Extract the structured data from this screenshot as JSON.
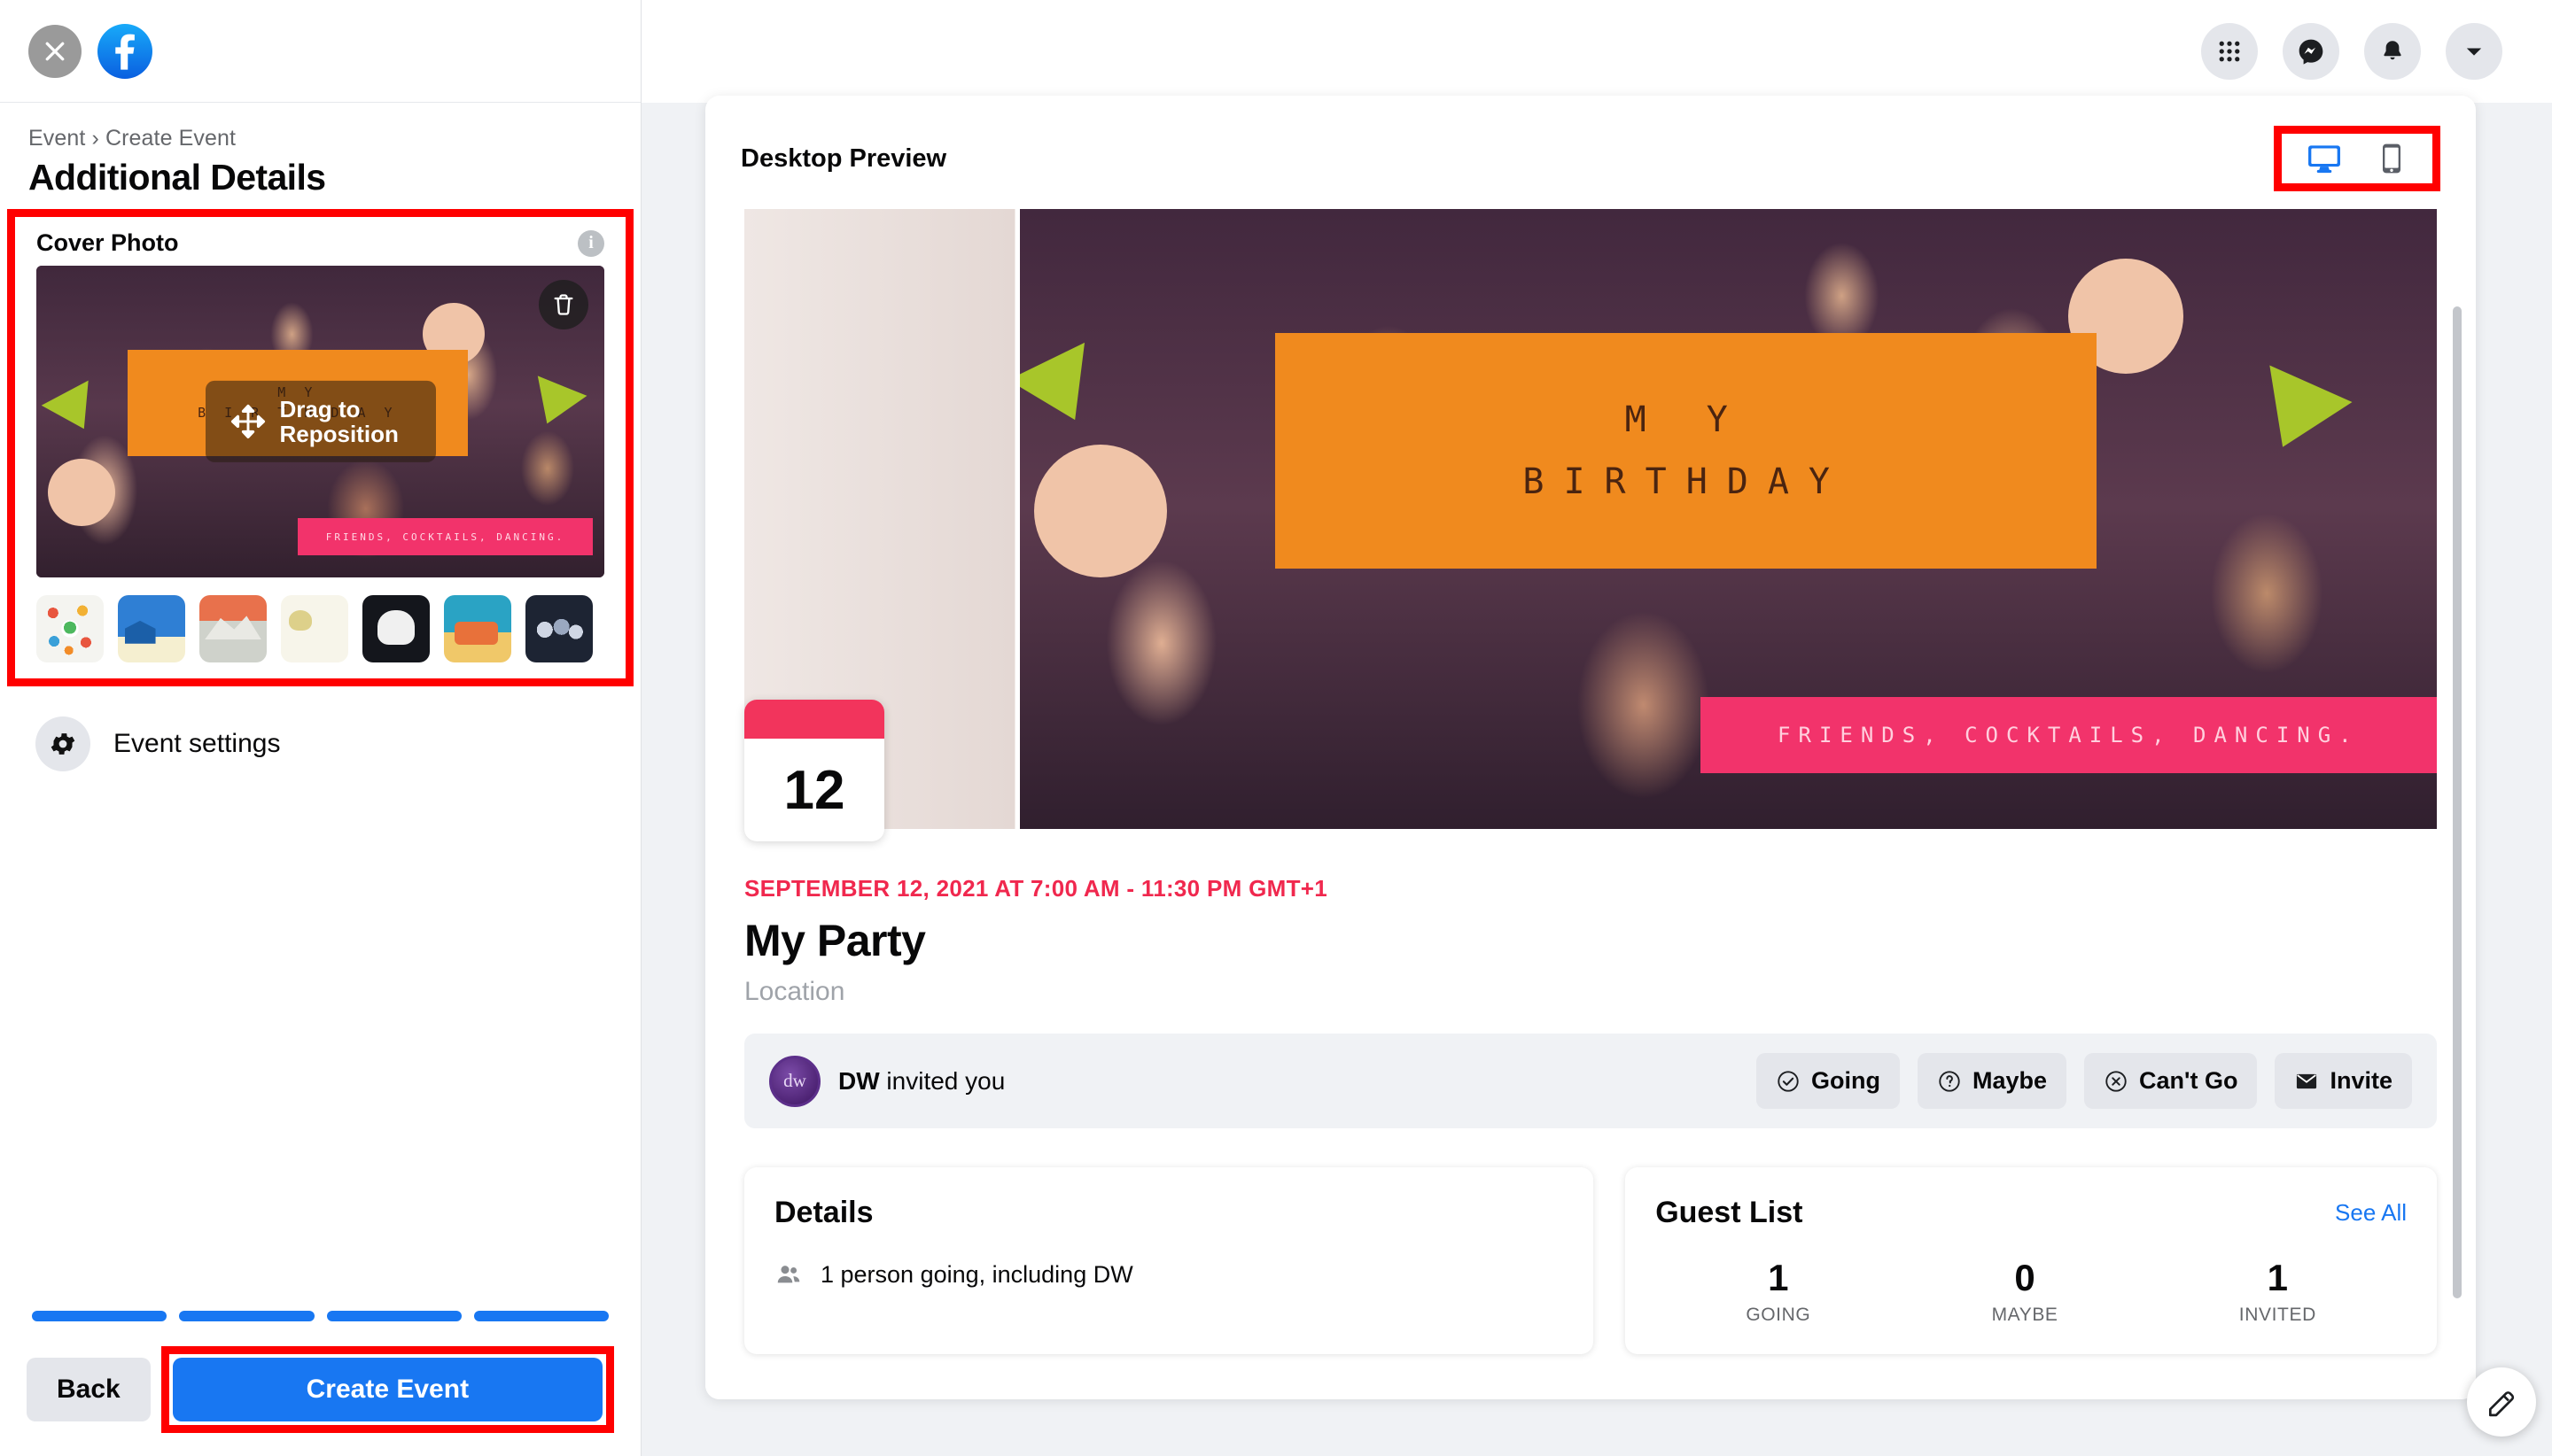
{
  "left_panel": {
    "close_icon": "close-icon",
    "logo_icon": "facebook-logo",
    "breadcrumb": "Event › Create Event",
    "page_title": "Additional Details",
    "cover_photo": {
      "label": "Cover Photo",
      "info_icon": "info-icon",
      "info_char": "i",
      "delete_icon": "trash-icon",
      "drag_icon": "move-icon",
      "drag_text": "Drag to Reposition",
      "image_band_line1": "M Y",
      "image_band_line2": "B I R T H D A Y",
      "image_pink_text": "FRIENDS, COCKTAILS, DANCING.",
      "thumbnails": [
        {
          "name": "thumbnail-picnic"
        },
        {
          "name": "thumbnail-winter-village"
        },
        {
          "name": "thumbnail-ski-mountain"
        },
        {
          "name": "thumbnail-desert-balloon"
        },
        {
          "name": "thumbnail-halloween-ghost"
        },
        {
          "name": "thumbnail-beach-sunset"
        },
        {
          "name": "thumbnail-night-crowd"
        }
      ]
    },
    "settings_row": {
      "icon": "gear-icon",
      "label": "Event settings"
    },
    "footer": {
      "progress_segments": 4,
      "back_label": "Back",
      "create_label": "Create Event"
    }
  },
  "top_nav": {
    "items": [
      {
        "name": "grid-menu-icon"
      },
      {
        "name": "messenger-icon"
      },
      {
        "name": "notifications-bell-icon"
      },
      {
        "name": "account-chevron-down-icon"
      }
    ]
  },
  "preview": {
    "title": "Desktop Preview",
    "device_toggle": {
      "desktop": {
        "name": "desktop-icon",
        "active": true,
        "color": "#1877f2"
      },
      "mobile": {
        "name": "mobile-icon",
        "active": false,
        "color": "#5a5e66"
      }
    },
    "hero": {
      "line1": "M Y",
      "line2": "BIRTHDAY",
      "pink_text": "FRIENDS, COCKTAILS, DANCING."
    },
    "calendar_day": "12",
    "event_date": "SEPTEMBER 12, 2021 AT 7:00 AM - 11:30 PM GMT+1",
    "event_name": "My Party",
    "event_location": "Location",
    "rsvp": {
      "avatar_initials": "dw",
      "inviter": "DW",
      "invited_text": " invited you",
      "buttons": [
        {
          "label": "Going",
          "icon": "check-circle-icon"
        },
        {
          "label": "Maybe",
          "icon": "question-circle-icon"
        },
        {
          "label": "Can't Go",
          "icon": "x-circle-icon"
        },
        {
          "label": "Invite",
          "icon": "envelope-icon"
        }
      ]
    },
    "details_card": {
      "title": "Details",
      "line_icon": "people-icon",
      "line_text": "1 person going, including DW"
    },
    "guest_card": {
      "title": "Guest List",
      "see_all": "See All",
      "stats": [
        {
          "number": "1",
          "label": "GOING"
        },
        {
          "number": "0",
          "label": "MAYBE"
        },
        {
          "number": "1",
          "label": "INVITED"
        }
      ]
    },
    "compose_fab_icon": "compose-pencil-icon"
  }
}
